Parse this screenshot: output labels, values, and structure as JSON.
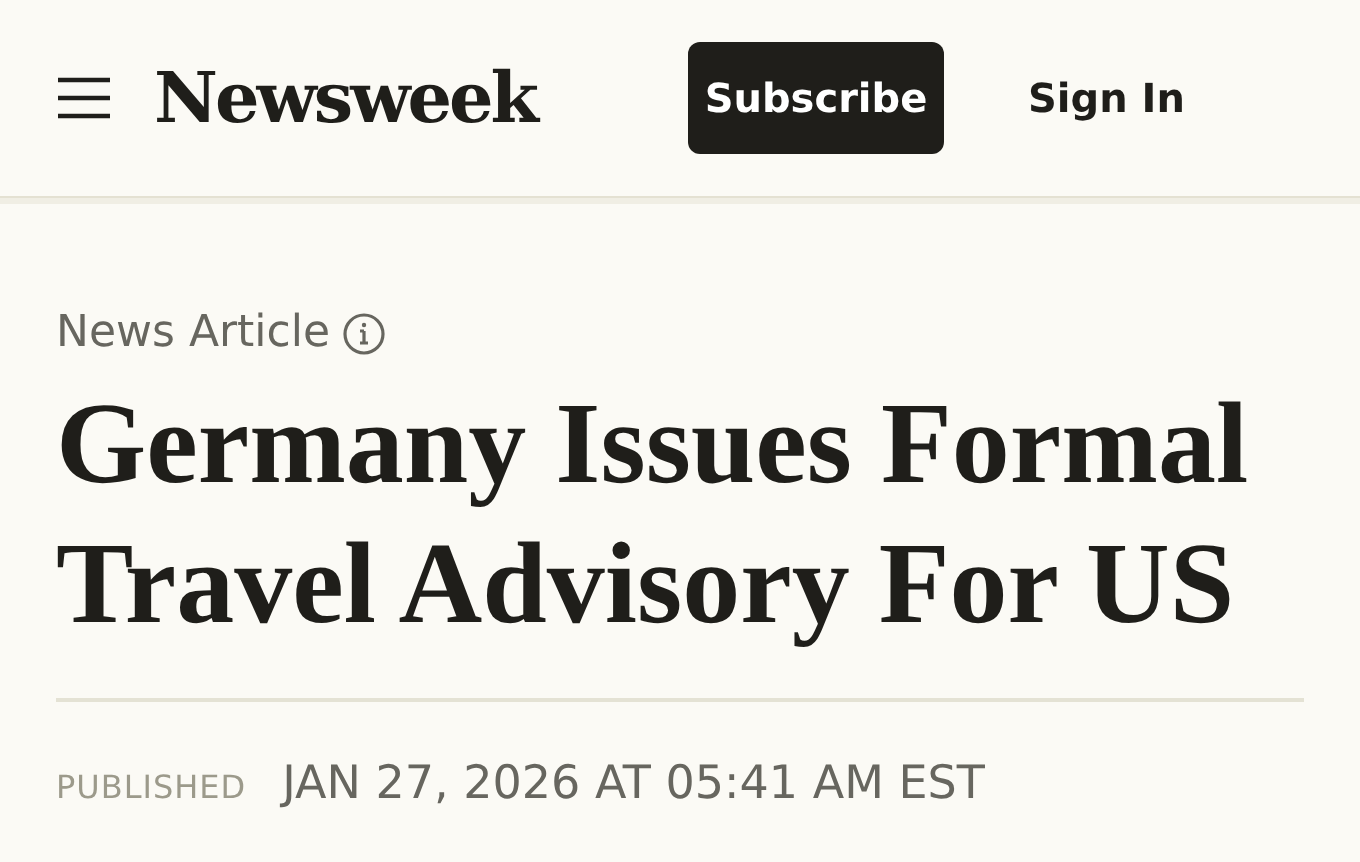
{
  "header": {
    "logo": "Newsweek",
    "subscribe": "Subscribe",
    "sign_in": "Sign In"
  },
  "article": {
    "category": "News Article",
    "headline": "Germany Issues Formal Travel Advisory For US",
    "published_label": "PUBLISHED",
    "published_date": "JAN 27, 2026 AT 05:41 AM EST"
  }
}
